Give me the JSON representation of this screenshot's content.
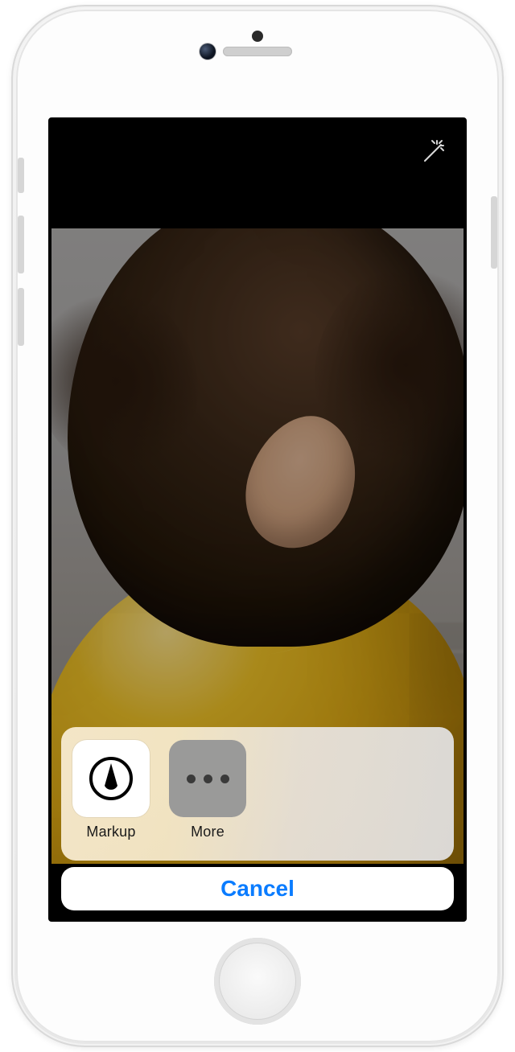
{
  "editor": {
    "wand_icon": "magic-wand"
  },
  "action_sheet": {
    "items": [
      {
        "label": "Markup",
        "icon": "markup-icon"
      },
      {
        "label": "More",
        "icon": "more-icon"
      }
    ],
    "cancel_label": "Cancel"
  },
  "colors": {
    "ios_blue": "#0a7cff"
  }
}
